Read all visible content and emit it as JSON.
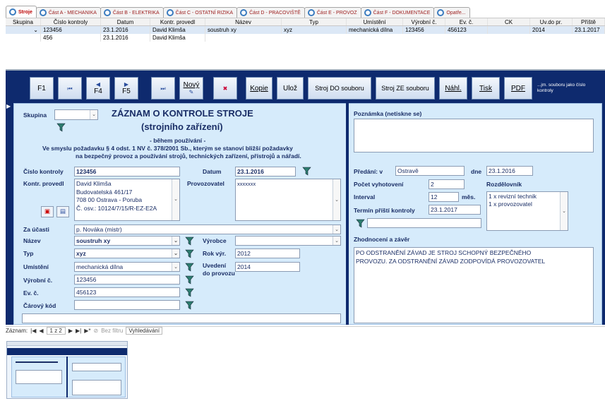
{
  "tabs": [
    "Stroje",
    "Část A - MECHANIKA",
    "Část B - ELEKTRIKA",
    "Část C - OSTATNÍ RIZIKA",
    "Část D - PRACOVIŠTĚ",
    "Část E - PROVOZ",
    "Část F - DOKUMENTACE",
    "Opatře..."
  ],
  "datasheet": {
    "columns": [
      "Skupina",
      "Číslo kontroly",
      "Datum",
      "Kontr. provedl",
      "Název",
      "Typ",
      "Umístění",
      "Výrobní č.",
      "Ev. č.",
      "CK",
      "Uv.do pr.",
      "Příště"
    ],
    "rows": [
      [
        "",
        "123456",
        "23.1.2016",
        "David Klimša",
        "soustruh xy",
        "xyz",
        "mechanická dílna",
        "123456",
        "456123",
        "",
        "2014",
        "23.1.2017"
      ],
      [
        "",
        "456",
        "23.1.2016",
        "David Klimša",
        "",
        "",
        "",
        "",
        "",
        "",
        "",
        ""
      ]
    ]
  },
  "toolbar": {
    "f1": "F1",
    "f4": "F4",
    "f5": "F5",
    "novy": "Nový",
    "kopie": "Kopie",
    "uloz": "Ulož",
    "stroj_do": "Stroj DO souboru",
    "stroj_ze": "Stroj ZE souboru",
    "nahl": "Náhl.",
    "tisk": "Tisk",
    "pdf": "PDF",
    "note": "...jm. souboru jako číslo kontroly"
  },
  "form": {
    "skupina_label": "Skupina",
    "title": "ZÁZNAM O KONTROLE STROJE",
    "subtitle": "(strojního zařízení)",
    "during": "- během používání -",
    "law1": "Ve smyslu požadavku § 4 odst. 1 NV č. 378/2001 Sb., kterým se stanoví bližší požadavky",
    "law2": "na bezpečný provoz a používání strojů, technických zařízení, přístrojů a nářadí.",
    "cislo_label": "Číslo kontroly",
    "cislo": "123456",
    "datum_label": "Datum",
    "datum": "23.1.2016",
    "kontr_label": "Kontr. provedl",
    "kontr_lines": [
      "David Klimša",
      "Budovatelská 461/17",
      "708 00 Ostrava - Poruba",
      "Č. osv.: 10124/7/15/R-EZ-E2A"
    ],
    "provoz_label": "Provozovatel",
    "provoz": "xxxxxxx",
    "ucast_label": "Za účasti",
    "ucast": "p. Nováka (mistr)",
    "nazev_label": "Název",
    "nazev": "soustruh xy",
    "vyrobce_label": "Výrobce",
    "vyrobce": "",
    "typ_label": "Typ",
    "typ": "xyz",
    "rokvyr_label": "Rok výr.",
    "rokvyr": "2012",
    "umisteni_label": "Umístění",
    "umisteni": "mechanická dílna",
    "uvedeni_label1": "Uvedení",
    "uvedeni_label2": "do provozu",
    "uvedeni": "2014",
    "vyrc_label": "Výrobní č.",
    "vyrc": "123456",
    "evc_label": "Ev. č.",
    "evc": "456123",
    "carovy_label": "Čárový kód",
    "carovy": "",
    "poznamka_label": "Poznámka (netiskne se)",
    "predani_label": "Předání: v",
    "predani": "Ostravě",
    "dne_label": "dne",
    "dne": "23.1.2016",
    "pocet_label": "Počet vyhotovení",
    "pocet": "2",
    "rozdel_label": "Rozdělovník",
    "rozdel_lines": [
      "1 x revizní technik",
      "1 x provozovatel"
    ],
    "interval_label": "Interval",
    "interval": "12",
    "mes": "měs.",
    "termin_label": "Termín příští kontroly",
    "termin": "23.1.2017",
    "zhodn_label": "Zhodnocení a závěr",
    "zhodn_lines": [
      "PO ODSTRANĚNÍ ZÁVAD JE STROJ SCHOPNÝ BEZPEČNÉHO",
      "PROVOZU. ZA ODSTRANĚNÍ ZÁVAD ZODPOVÍDÁ PROVOZOVATEL"
    ]
  },
  "navbar": {
    "zaznam": "Záznam:",
    "pos": "1 z 2",
    "filtr": "Bez filtru",
    "hledat": "Vyhledávání"
  }
}
